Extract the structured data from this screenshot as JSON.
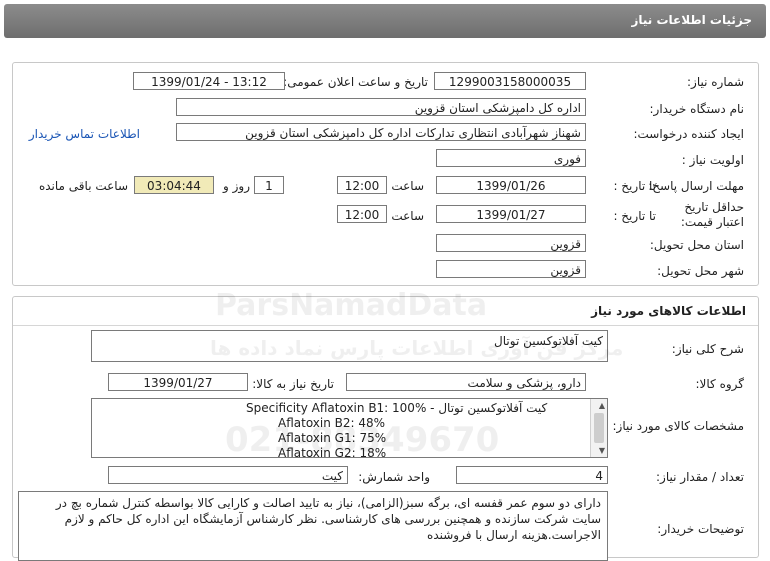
{
  "page_title": "جزئیات اطلاعات نیاز",
  "form": {
    "need_number_label": "شماره نیاز:",
    "need_number": "1299003158000035",
    "announce_label": "تاریخ و ساعت اعلان عمومی:",
    "announce_value": "1399/01/24 - 13:12",
    "buyer_org_label": "نام دستگاه خریدار:",
    "buyer_org": "اداره کل دامپزشکی استان قزوین",
    "creator_label": "ایجاد کننده درخواست:",
    "creator": "شهناز شهرآبادی انتظاری تدارکات اداره کل دامپزشکی استان قزوین",
    "contact_link": "اطلاعات تماس خریدار",
    "priority_label": "اولویت نیاز :",
    "priority": "فوری",
    "reply_deadline_label": "مهلت ارسال پاسخ:",
    "to_date_label": "تا تاریخ :",
    "reply_date": "1399/01/26",
    "time_label": "ساعت",
    "reply_time": "12:00",
    "days_value": "1",
    "days_label": "روز و",
    "remaining_time": "03:04:44",
    "remaining_label": "ساعت باقی مانده",
    "validity_label": "حداقل تاریخ اعتبار قیمت:",
    "validity_to_label": "تا تاریخ :",
    "validity_date": "1399/01/27",
    "validity_time_label": "ساعت",
    "validity_time": "12:00",
    "province_label": "استان محل تحویل:",
    "province": "قزوین",
    "city_label": "شهر محل تحویل:",
    "city": "قزوین"
  },
  "goods": {
    "section_title": "اطلاعات کالاهای مورد نیاز",
    "summary_label": "شرح کلی نیاز:",
    "summary": "کیت آفلاتوکسین توتال",
    "group_label": "گروه کالا:",
    "group": "دارو، پزشکی و سلامت",
    "need_date_label": "تاریخ نیاز به کالا:",
    "need_date": "1399/01/27",
    "specs_label": "مشخصات کالای مورد نیاز:",
    "spec_lines": [
      "کیت آفلاتوکسین توتال - Specificity Aflatoxin B1: 100%",
      "Aflatoxin B2: 48%",
      "Aflatoxin G1: 75%",
      "Aflatoxin G2: 18%"
    ],
    "quantity_label": "تعداد / مقدار نیاز:",
    "quantity": "4",
    "unit_label": "واحد شمارش:",
    "unit": "کیت",
    "buyer_notes_label": "توضیحات خریدار:",
    "buyer_notes": "دارای دو سوم عمر قفسه ای، برگه سبز(الزامی)، نیاز به تایید اصالت و کارایی کالا بواسطه کنترل شماره بچ در سایت شرکت سازنده و همچنین بررسی های کارشناسی. نظر کارشناس آزمایشگاه این اداره کل حاکم و لازم الاجراست.هزینه ارسال با فروشنده"
  },
  "watermark": {
    "brand": "ParsNamadData",
    "fa_line": "مرکز فن آوری اطلاعات پارس نماد داده ها",
    "phone": "021-88349670"
  }
}
